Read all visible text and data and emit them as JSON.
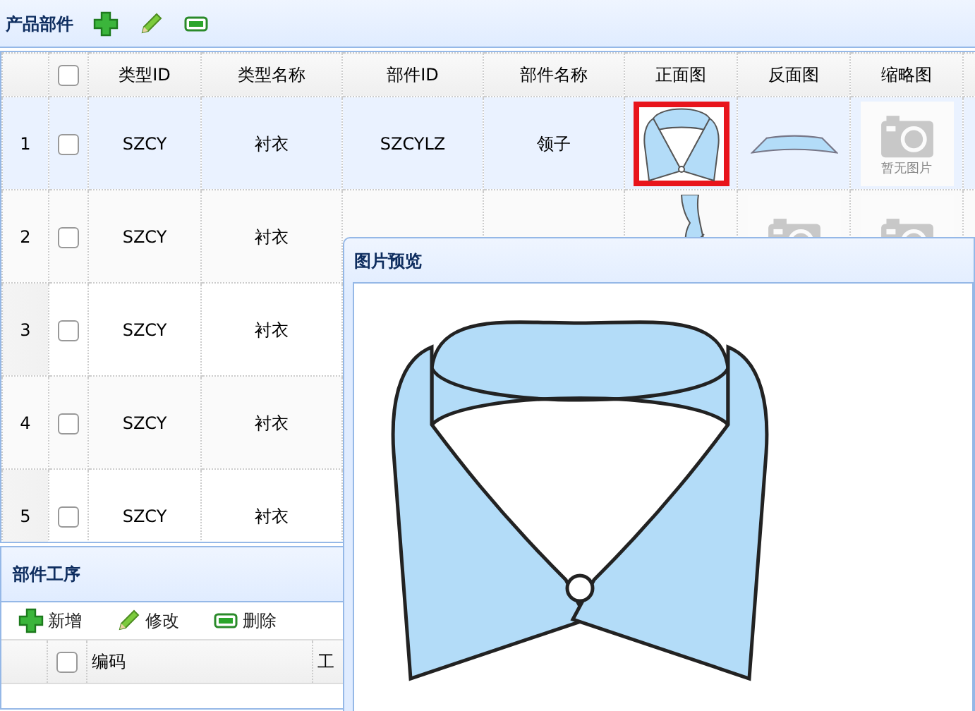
{
  "panel": {
    "title": "产品部件",
    "tools": [
      {
        "kind": "add"
      },
      {
        "kind": "edit"
      },
      {
        "kind": "remove"
      }
    ]
  },
  "table": {
    "header_checked": false,
    "columns": [
      "类型ID",
      "类型名称",
      "部件ID",
      "部件名称",
      "正面图",
      "反面图",
      "缩略图"
    ],
    "rows": [
      {
        "index": "1",
        "selected": true,
        "checked": false,
        "cells": [
          "SZCY",
          "衬衣",
          "SZCYLZ",
          "领子"
        ],
        "images": [
          {
            "kind": "collar",
            "selected": true
          },
          {
            "kind": "band",
            "selected": false
          },
          {
            "kind": "placeholder",
            "selected": false,
            "caption": "暂无图片"
          }
        ]
      },
      {
        "index": "2",
        "selected": false,
        "checked": false,
        "cells": [
          "SZCY",
          "衬衣"
        ],
        "images": [
          {
            "kind": "sleeve",
            "selected": false
          },
          {
            "kind": "placeholder",
            "selected": false
          },
          {
            "kind": "placeholder",
            "selected": false
          }
        ]
      },
      {
        "index": "3",
        "selected": false,
        "checked": false,
        "cells": [
          "SZCY",
          "衬衣"
        ],
        "images": []
      },
      {
        "index": "4",
        "selected": false,
        "checked": false,
        "cells": [
          "SZCY",
          "衬衣"
        ],
        "images": []
      },
      {
        "index": "5",
        "selected": false,
        "checked": false,
        "cells": [
          "SZCY",
          "衬衣"
        ],
        "images": []
      }
    ]
  },
  "process_panel": {
    "title": "部件工序",
    "buttons": [
      {
        "kind": "add",
        "label": "新增"
      },
      {
        "kind": "edit",
        "label": "修改"
      },
      {
        "kind": "remove",
        "label": "删除"
      }
    ],
    "header_checked": false,
    "columns": [
      "编码",
      "工"
    ]
  },
  "preview": {
    "title": "图片预览"
  }
}
